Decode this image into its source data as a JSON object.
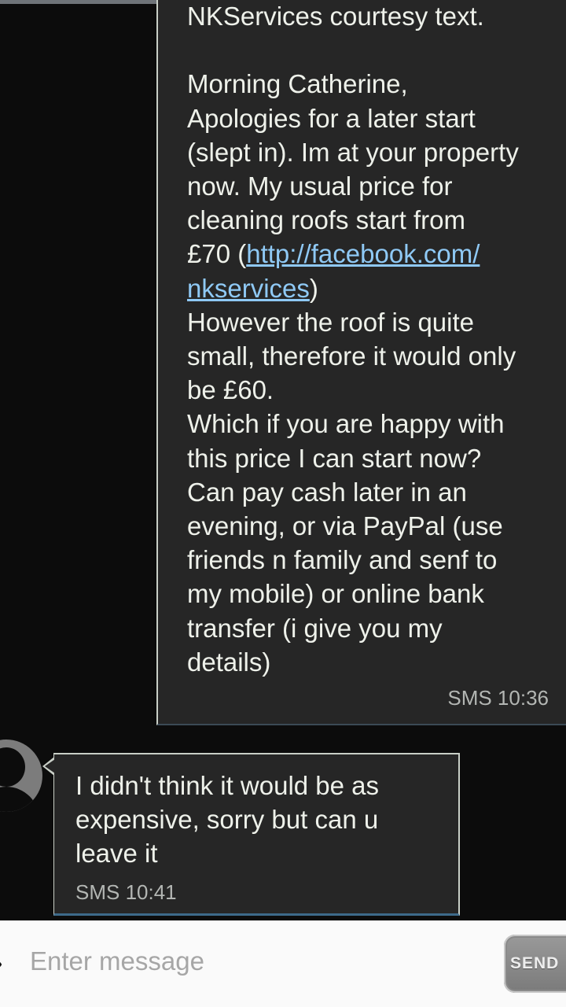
{
  "conversation": {
    "outgoing": {
      "text_part1": "NKServices courtesy text.\n\nMorning Catherine,\nApologies for a later start\n(slept in). Im at your property\nnow. My usual price for\ncleaning roofs start from\n£70 (",
      "link_line1": "http://facebook.com/",
      "link_line2": "nkservices",
      "text_part2": ")\nHowever the roof is quite\nsmall, therefore it would only\nbe £60.\nWhich if you are happy with\nthis price I can start now?\nCan pay cash later in an\nevening, or via PayPal (use\nfriends n family and senf to\nmy mobile) or online bank\ntransfer (i give you my\ndetails)",
      "timestamp": "SMS 10:36"
    },
    "incoming": {
      "text": "I didn't think it would be as\nexpensive, sorry but can u\nleave it",
      "timestamp": "SMS 10:41"
    }
  },
  "compose": {
    "placeholder": "Enter message",
    "send_label": "SEND"
  },
  "colors": {
    "background": "#0c0c0c",
    "bubble": "#262626",
    "text": "#eef1ea",
    "link": "#8fc9f5",
    "timestamp": "#b3b6b3",
    "compose_bg": "#fafafa"
  }
}
